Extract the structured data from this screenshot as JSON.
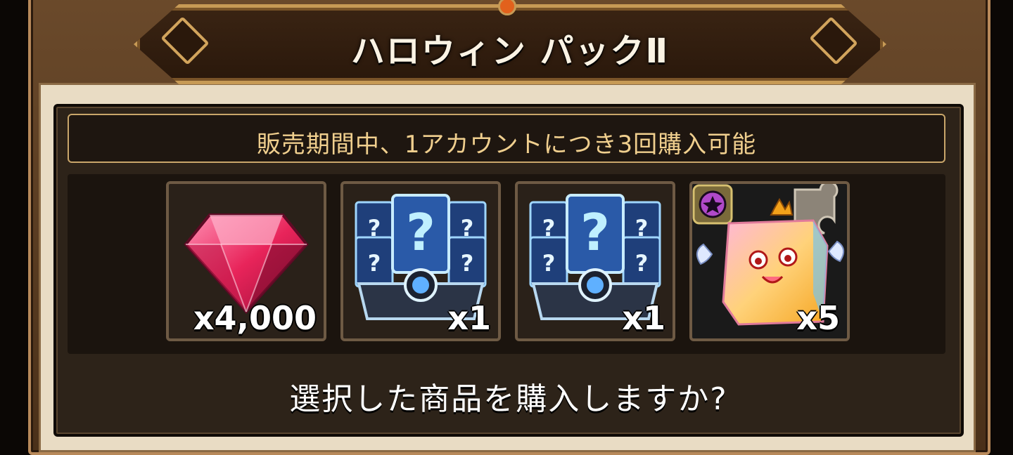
{
  "title": "ハロウィン パックⅡ",
  "notice": "販売期間中、1アカウントにつき3回購入可能",
  "items": [
    {
      "icon": "ruby-gem-icon",
      "quantity": "x4,000"
    },
    {
      "icon": "mystery-card-chest-icon",
      "quantity": "x1"
    },
    {
      "icon": "mystery-card-chest-icon",
      "quantity": "x1"
    },
    {
      "icon": "cube-creature-puzzle-piece-icon",
      "quantity": "x5"
    }
  ],
  "question": "選択した商品を購入しますか?",
  "colors": {
    "frame": "#6b4a2b",
    "banner": "#2a180b",
    "gold": "#c79a55",
    "notice_text": "#f0cf8e",
    "panel": "#2d2319"
  }
}
